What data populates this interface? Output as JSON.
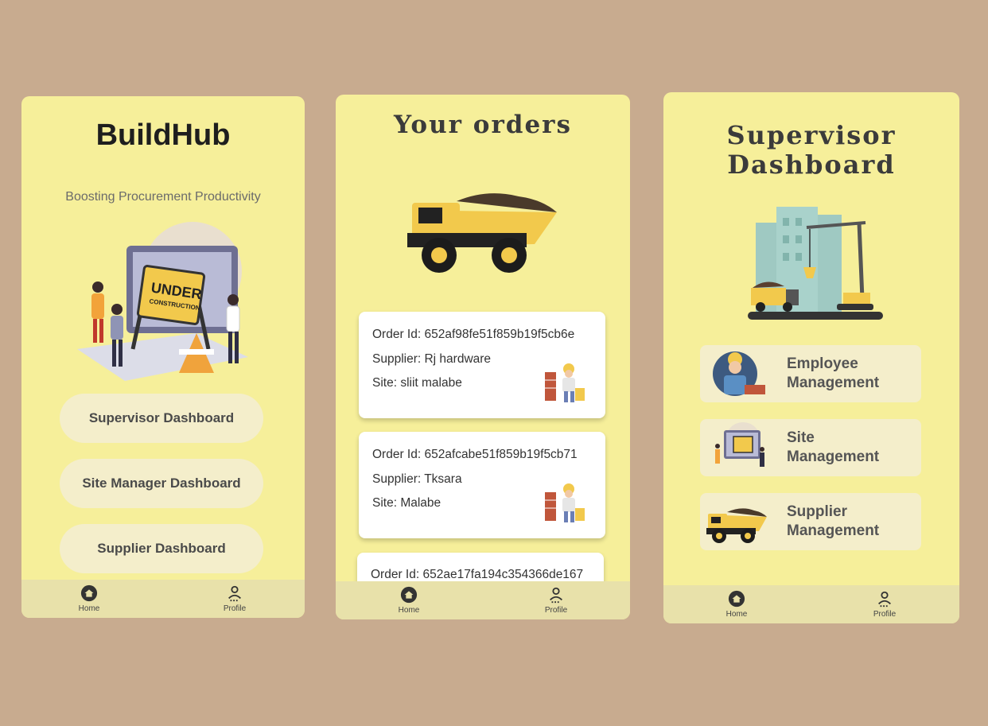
{
  "screen1": {
    "title": "BuildHub",
    "subtitle": "Boosting Procurement Productivity",
    "buttons": [
      "Supervisor Dashboard",
      "Site Manager Dashboard",
      "Supplier Dashboard"
    ],
    "illustration_sign": [
      "UNDER",
      "CONSTRUCTION"
    ]
  },
  "screen2": {
    "title": "Your orders",
    "orders": [
      {
        "id": "Order Id: 652af98fe51f859b19f5cb6e",
        "supplier": "Supplier: Rj hardware",
        "site": "Site: sliit malabe"
      },
      {
        "id": "Order Id: 652afcabe51f859b19f5cb71",
        "supplier": "Supplier: Tksara",
        "site": "Site: Malabe"
      },
      {
        "id": "Order Id: 652ae17fa194c354366de167"
      }
    ]
  },
  "screen3": {
    "title_line1": "Supervisor",
    "title_line2": "Dashboard",
    "menu": [
      {
        "line1": "Employee",
        "line2": "Management",
        "icon": "worker-icon"
      },
      {
        "line1": "Site",
        "line2": "Management",
        "icon": "construction-site-icon"
      },
      {
        "line1": "Supplier",
        "line2": "Management",
        "icon": "dump-truck-icon"
      }
    ]
  },
  "nav": {
    "home": "Home",
    "profile": "Profile"
  },
  "colors": {
    "background": "#c8ab8f",
    "screen": "#f6ef9a",
    "navbar": "#e8e1aa",
    "button": "#f4eecb",
    "accent": "#f2c94c"
  }
}
